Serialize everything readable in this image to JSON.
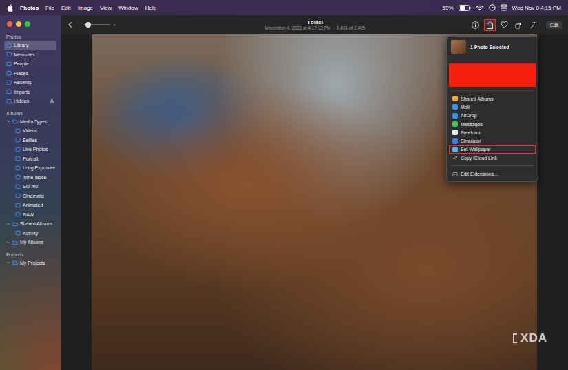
{
  "menubar": {
    "app": "Photos",
    "menus": [
      "File",
      "Edit",
      "Image",
      "View",
      "Window",
      "Help"
    ],
    "battery": "59%",
    "battery_level": 0.59,
    "clock": "Wed Nov 8  4:15 PM"
  },
  "window": {
    "title": "Tbilisi",
    "subtitle": "November 4, 2023 at 4:17:12 PM",
    "separator": "·",
    "counter": "2,401 of 2,405"
  },
  "zoom": {
    "minus": "−",
    "plus": "+",
    "level": 0.15
  },
  "toolbar": {
    "buttons": [
      {
        "kind": "info",
        "selected": false
      },
      {
        "kind": "share",
        "selected": true
      },
      {
        "kind": "heart",
        "selected": false
      },
      {
        "kind": "rotate",
        "selected": false
      },
      {
        "kind": "magic",
        "selected": false
      }
    ],
    "edit": "Edit"
  },
  "sidebar": {
    "sections": [
      {
        "title": "Photos",
        "items": [
          {
            "label": "Library",
            "selected": true,
            "locked": false
          },
          {
            "label": "Memories",
            "selected": false,
            "locked": false
          },
          {
            "label": "People",
            "selected": false,
            "locked": false
          },
          {
            "label": "Places",
            "selected": false,
            "locked": false
          },
          {
            "label": "Recents",
            "selected": false,
            "locked": false
          },
          {
            "label": "Imports",
            "selected": false,
            "locked": false
          },
          {
            "label": "Hidden",
            "selected": false,
            "locked": true
          }
        ]
      },
      {
        "title": "Albums",
        "items": [
          {
            "label": "Media Types",
            "selected": false,
            "expanded": true,
            "children": [
              {
                "label": "Videos",
                "selected": false
              },
              {
                "label": "Selfies",
                "selected": false
              },
              {
                "label": "Live Photos",
                "selected": false
              },
              {
                "label": "Portrait",
                "selected": false
              },
              {
                "label": "Long Exposure",
                "selected": false
              },
              {
                "label": "Time-lapse",
                "selected": false
              },
              {
                "label": "Slo-mo",
                "selected": false
              },
              {
                "label": "Cinematic",
                "selected": false
              },
              {
                "label": "Animated",
                "selected": false
              },
              {
                "label": "RAW",
                "selected": false
              }
            ]
          },
          {
            "label": "Shared Albums",
            "selected": false,
            "expanded": true,
            "children": [
              {
                "label": "Activity",
                "selected": false
              }
            ]
          },
          {
            "label": "My Albums",
            "selected": false,
            "expanded": true,
            "children": []
          }
        ]
      },
      {
        "title": "Projects",
        "items": [
          {
            "label": "My Projects",
            "selected": false,
            "expanded": true,
            "children": []
          }
        ]
      }
    ]
  },
  "share_menu": {
    "header": "1 Photo Selected",
    "items": [
      {
        "label": "Shared Albums",
        "selected": false,
        "kind": "app",
        "color": "#f0a23a"
      },
      {
        "label": "Mail",
        "selected": false,
        "kind": "app",
        "color": "#3a8ef0"
      },
      {
        "label": "AirDrop",
        "selected": false,
        "kind": "app",
        "color": "#2f9bf0"
      },
      {
        "label": "Messages",
        "selected": false,
        "kind": "app",
        "color": "#3fc85a"
      },
      {
        "label": "Freeform",
        "selected": false,
        "kind": "app",
        "color": "#e8eef7"
      },
      {
        "label": "Simulator",
        "selected": false,
        "kind": "app",
        "color": "#3a7fe0"
      },
      {
        "label": "Set Wallpaper",
        "selected": true,
        "kind": "app",
        "color": "#4fb2e8"
      },
      {
        "label": "Copy iCloud Link",
        "selected": false,
        "kind": "link",
        "color": "#c8c8c8"
      }
    ],
    "footer": "Edit Extensions…"
  },
  "watermark": "XDA"
}
